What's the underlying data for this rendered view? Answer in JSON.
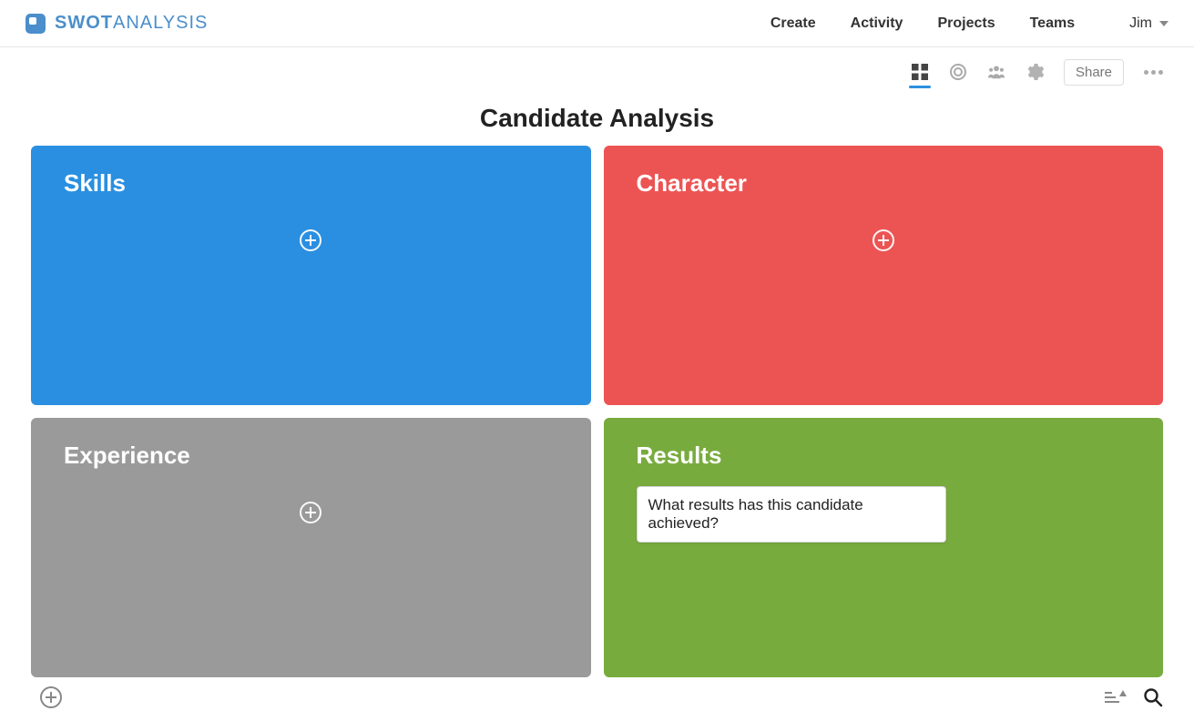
{
  "brand": {
    "strong": "SWOT",
    "light": "ANALYSIS"
  },
  "nav": {
    "create": "Create",
    "activity": "Activity",
    "projects": "Projects",
    "teams": "Teams"
  },
  "user": {
    "name": "Jim"
  },
  "toolbar": {
    "share": "Share"
  },
  "page": {
    "title": "Candidate Analysis"
  },
  "quadrants": {
    "skills": {
      "title": "Skills"
    },
    "character": {
      "title": "Character"
    },
    "experience": {
      "title": "Experience"
    },
    "results": {
      "title": "Results",
      "note": "What results has this candidate achieved?"
    }
  },
  "colors": {
    "skills": "#2a8fe0",
    "character": "#ec5453",
    "experience": "#9a9a9a",
    "results": "#78ab3e",
    "brand": "#4b8ecb"
  }
}
